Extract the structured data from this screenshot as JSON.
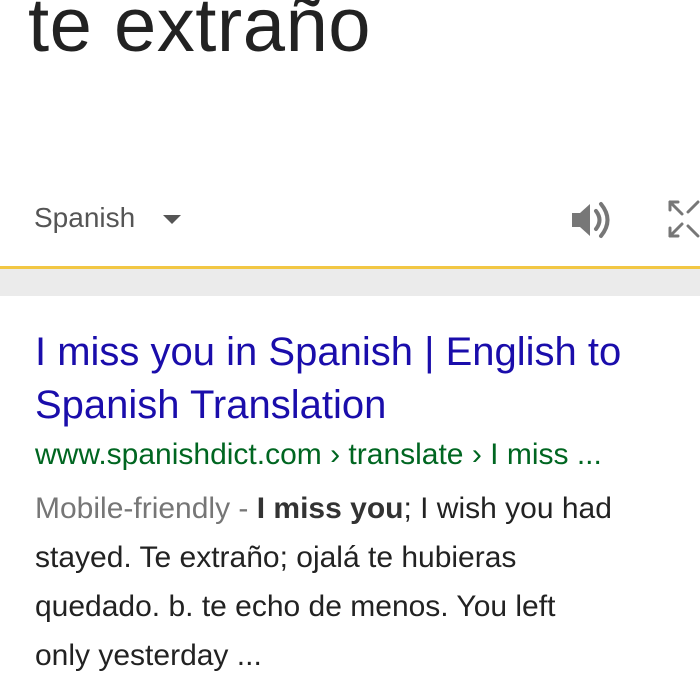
{
  "translation": {
    "text": "te extraño",
    "language": "Spanish"
  },
  "icons": {
    "dropdown": "chevron-down-icon",
    "speaker": "speaker-icon",
    "expand": "expand-icon"
  },
  "colors": {
    "accent_underline": "#f2c744",
    "link": "#1a0dab",
    "url": "#006621",
    "text": "#222222",
    "muted": "#767676"
  },
  "result": {
    "title_line1": "I miss you in Spanish | English to",
    "title_line2": "Spanish Translation",
    "url": "www.spanishdict.com › translate › I miss ...",
    "badge": "Mobile-friendly",
    "separator": " - ",
    "bold_term": "I miss you",
    "snippet_line1_rest": "; I wish you had",
    "snippet_line2": "stayed. Te extraño; ojalá te hubieras",
    "snippet_line3": "quedado. b. te echo de menos. You left",
    "snippet_line4": "only yesterday ..."
  }
}
